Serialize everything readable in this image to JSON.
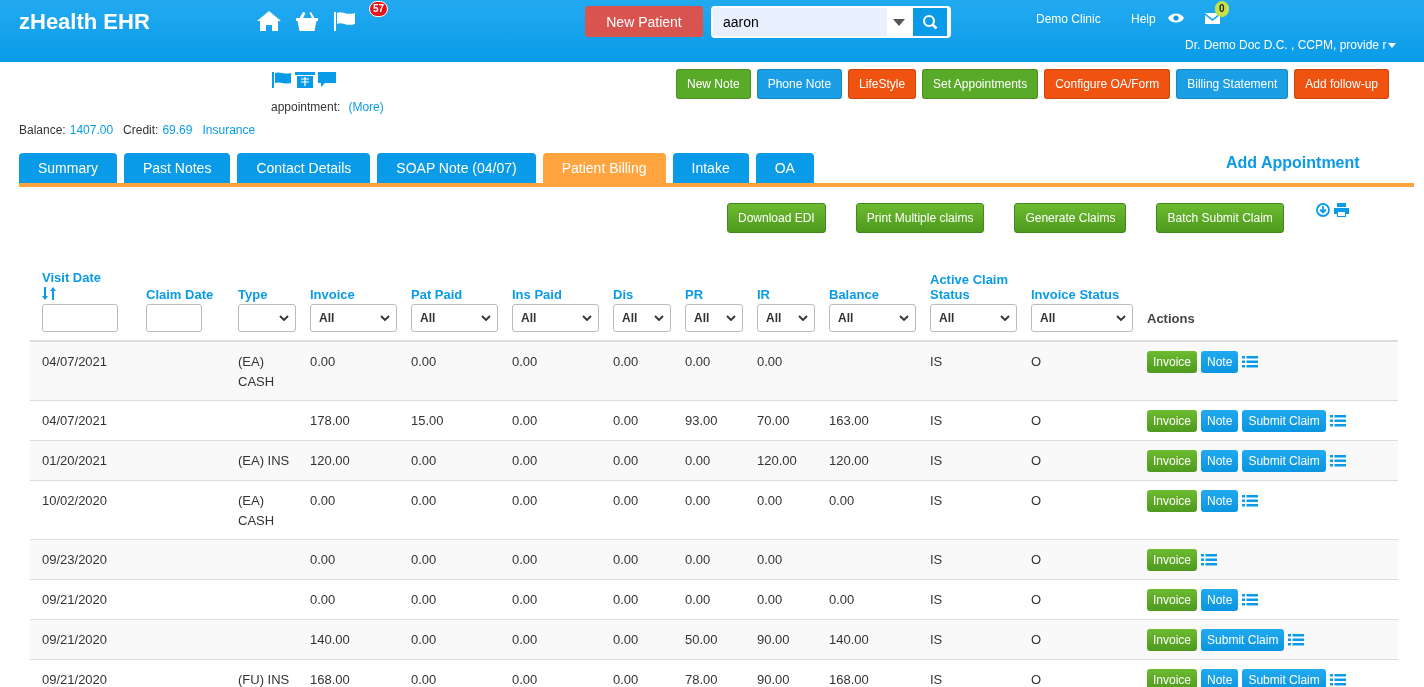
{
  "header": {
    "brand": "zHealth EHR",
    "notification_count": "57",
    "new_patient": "New Patient",
    "search": {
      "value": "aaron"
    },
    "clinic": "Demo Clinic",
    "help": "Help",
    "mail_count": "0",
    "user": "Dr. Demo Doc D.C. , CCPM, provide r"
  },
  "patient": {
    "appointment_label": "appointment:",
    "more_link": "(More)",
    "balance_label": "Balance:",
    "balance": "1407.00",
    "credit_label": "Credit:",
    "credit": "69.69",
    "insurance_link": "Insurance"
  },
  "action_buttons": [
    {
      "label": "New Note",
      "color": "#5aaa2a"
    },
    {
      "label": "Phone Note",
      "color": "#1a9fe6"
    },
    {
      "label": "LifeStyle",
      "color": "#f0520f"
    },
    {
      "label": "Set Appointments",
      "color": "#5aaa2a"
    },
    {
      "label": "Configure OA/Form",
      "color": "#f0520f"
    },
    {
      "label": "Billing Statement",
      "color": "#1a9fe6"
    },
    {
      "label": "Add follow-up",
      "color": "#f0520f"
    }
  ],
  "tabs": [
    {
      "label": "Summary",
      "selected": false
    },
    {
      "label": "Past Notes",
      "selected": false
    },
    {
      "label": "Contact Details",
      "selected": false
    },
    {
      "label": "SOAP Note (04/07)",
      "selected": false
    },
    {
      "label": "Patient Billing",
      "selected": true
    },
    {
      "label": "Intake",
      "selected": false
    },
    {
      "label": "OA",
      "selected": false
    }
  ],
  "add_appointment": "Add Appointment",
  "billing_buttons": [
    "Download EDI",
    "Print Multiple claims",
    "Generate Claims",
    "Batch Submit Claim"
  ],
  "table": {
    "columns": [
      {
        "label": "Visit Date",
        "sortable": true,
        "filter": {
          "kind": "text"
        }
      },
      {
        "label": "Claim Date",
        "sortable": false,
        "filter": {
          "kind": "text"
        }
      },
      {
        "label": "Type",
        "sortable": false,
        "filter": {
          "kind": "select"
        }
      },
      {
        "label": "Invoice",
        "sortable": false,
        "filter": {
          "kind": "select",
          "value": "All"
        }
      },
      {
        "label": "Pat Paid",
        "sortable": false,
        "filter": {
          "kind": "select",
          "value": "All"
        }
      },
      {
        "label": "Ins Paid",
        "sortable": false,
        "filter": {
          "kind": "select",
          "value": "All"
        }
      },
      {
        "label": "Dis",
        "sortable": false,
        "filter": {
          "kind": "select",
          "value": "All"
        }
      },
      {
        "label": "PR",
        "sortable": false,
        "filter": {
          "kind": "select",
          "value": "All"
        }
      },
      {
        "label": "IR",
        "sortable": false,
        "filter": {
          "kind": "select",
          "value": "All"
        }
      },
      {
        "label": "Balance",
        "sortable": false,
        "filter": {
          "kind": "select",
          "value": "All"
        }
      },
      {
        "label": "Active Claim Status",
        "sortable": false,
        "filter": {
          "kind": "select",
          "value": "All"
        }
      },
      {
        "label": "Invoice Status",
        "sortable": false,
        "filter": {
          "kind": "select",
          "value": "All"
        }
      },
      {
        "label": "Actions",
        "sortable": false
      }
    ],
    "rows": [
      {
        "cells": [
          "04/07/2021",
          "",
          "(EA) CASH",
          "0.00",
          "0.00",
          "0.00",
          "0.00",
          "0.00",
          "0.00",
          "",
          "IS",
          "O"
        ],
        "actions": [
          {
            "kind": "invoice",
            "label": "Invoice"
          },
          {
            "kind": "note",
            "label": "Note"
          }
        ]
      },
      {
        "cells": [
          "04/07/2021",
          "",
          "",
          "178.00",
          "15.00",
          "0.00",
          "0.00",
          "93.00",
          "70.00",
          "163.00",
          "IS",
          "O"
        ],
        "actions": [
          {
            "kind": "invoice",
            "label": "Invoice"
          },
          {
            "kind": "note",
            "label": "Note"
          },
          {
            "kind": "submit",
            "label": "Submit Claim"
          }
        ]
      },
      {
        "cells": [
          "01/20/2021",
          "",
          "(EA) INS",
          "120.00",
          "0.00",
          "0.00",
          "0.00",
          "0.00",
          "120.00",
          "120.00",
          "IS",
          "O"
        ],
        "actions": [
          {
            "kind": "invoice",
            "label": "Invoice"
          },
          {
            "kind": "note",
            "label": "Note"
          },
          {
            "kind": "submit",
            "label": "Submit Claim"
          }
        ]
      },
      {
        "cells": [
          "10/02/2020",
          "",
          "(EA) CASH",
          "0.00",
          "0.00",
          "0.00",
          "0.00",
          "0.00",
          "0.00",
          "0.00",
          "IS",
          "O"
        ],
        "actions": [
          {
            "kind": "invoice",
            "label": "Invoice"
          },
          {
            "kind": "note",
            "label": "Note"
          }
        ]
      },
      {
        "cells": [
          "09/23/2020",
          "",
          "",
          "0.00",
          "0.00",
          "0.00",
          "0.00",
          "0.00",
          "0.00",
          "",
          "IS",
          "O"
        ],
        "actions": [
          {
            "kind": "invoice",
            "label": "Invoice"
          }
        ]
      },
      {
        "cells": [
          "09/21/2020",
          "",
          "",
          "0.00",
          "0.00",
          "0.00",
          "0.00",
          "0.00",
          "0.00",
          "0.00",
          "IS",
          "O"
        ],
        "actions": [
          {
            "kind": "invoice",
            "label": "Invoice"
          },
          {
            "kind": "note",
            "label": "Note"
          }
        ]
      },
      {
        "cells": [
          "09/21/2020",
          "",
          "",
          "140.00",
          "0.00",
          "0.00",
          "0.00",
          "50.00",
          "90.00",
          "140.00",
          "IS",
          "O"
        ],
        "actions": [
          {
            "kind": "invoice",
            "label": "Invoice"
          },
          {
            "kind": "submit",
            "label": "Submit Claim"
          }
        ]
      },
      {
        "cells": [
          "09/21/2020",
          "",
          "(FU) INS",
          "168.00",
          "0.00",
          "0.00",
          "0.00",
          "78.00",
          "90.00",
          "168.00",
          "IS",
          "O"
        ],
        "actions": [
          {
            "kind": "invoice",
            "label": "Invoice"
          },
          {
            "kind": "note",
            "label": "Note"
          },
          {
            "kind": "submit",
            "label": "Submit Claim"
          }
        ]
      }
    ]
  }
}
